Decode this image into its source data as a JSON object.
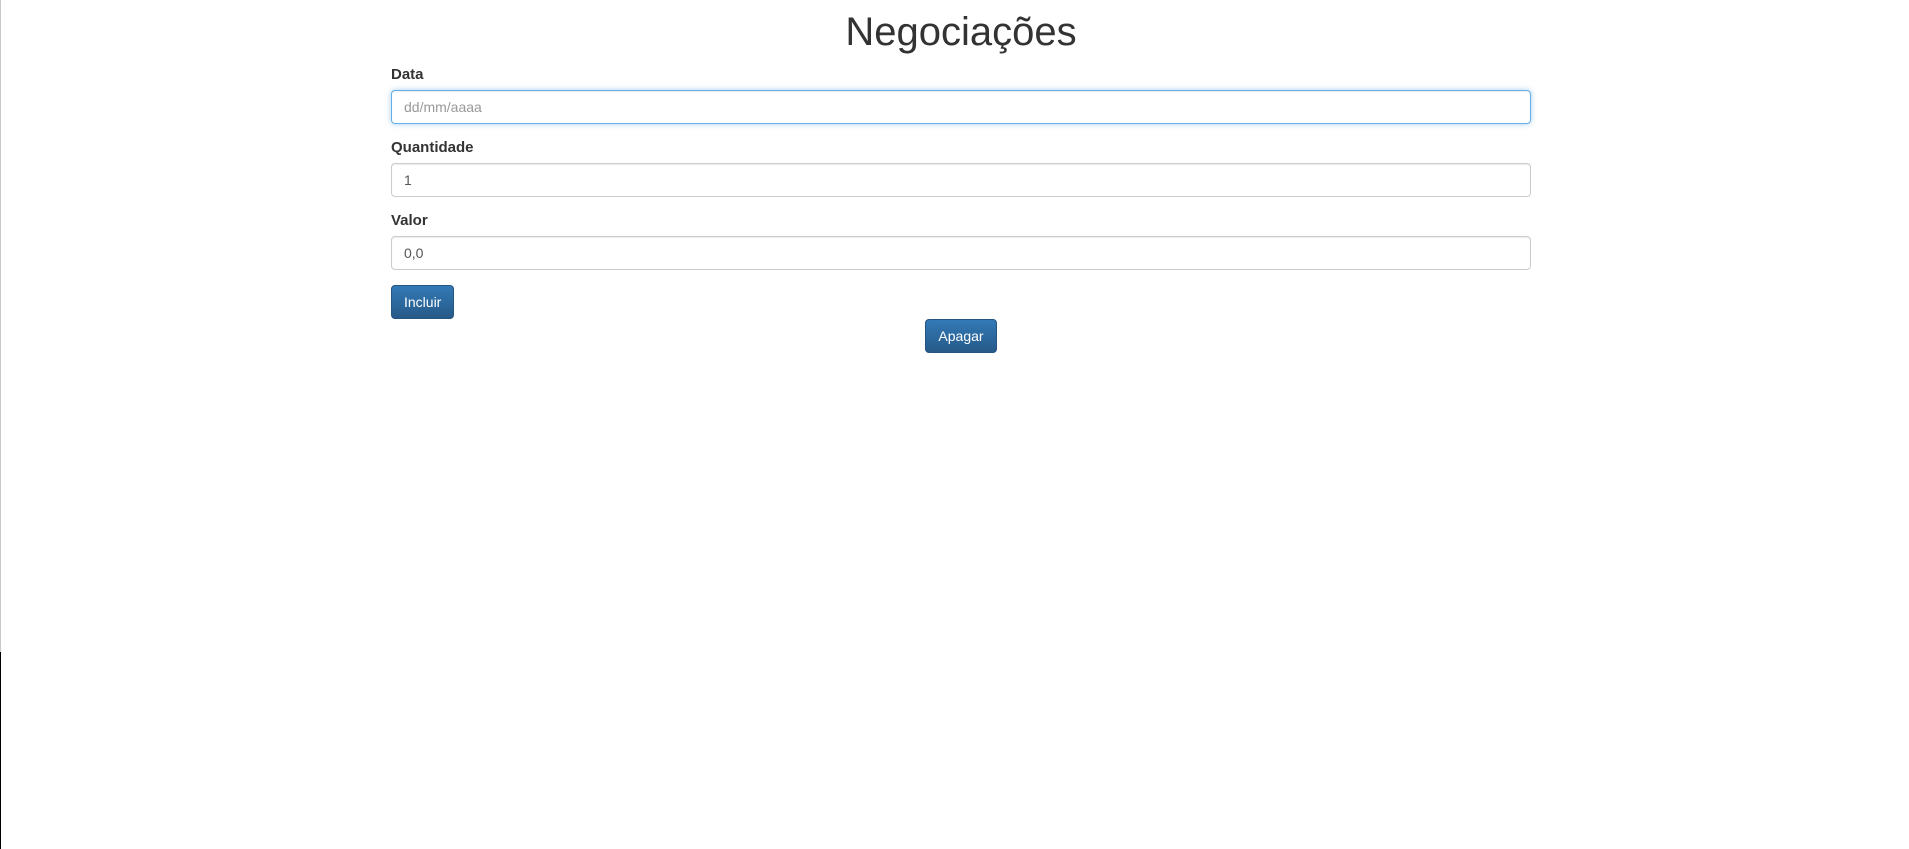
{
  "page": {
    "title": "Negociações"
  },
  "form": {
    "data_label": "Data",
    "data_placeholder": "dd/mm/aaaa",
    "data_value": "",
    "quantidade_label": "Quantidade",
    "quantidade_value": "1",
    "valor_label": "Valor",
    "valor_value": "0,0",
    "submit_label": "Incluir"
  },
  "actions": {
    "clear_label": "Apagar"
  },
  "colors": {
    "button_primary": "#337ab7",
    "focus_border": "#66afe9"
  }
}
